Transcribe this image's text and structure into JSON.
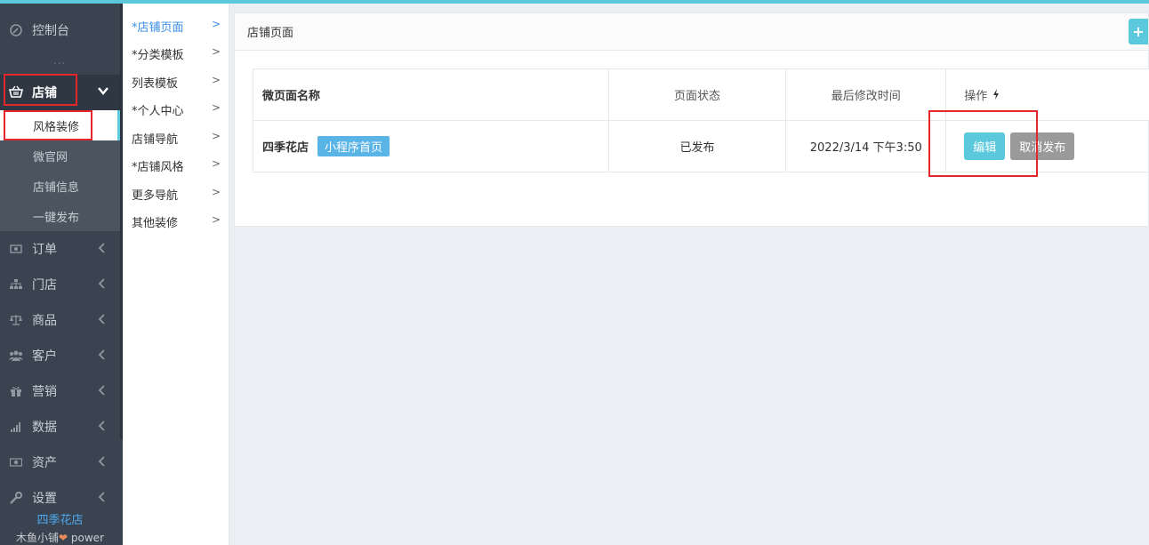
{
  "sidebar": {
    "dashboard": "控制台",
    "dots": "...",
    "shop": "店铺",
    "sub_items": [
      "风格装修",
      "微官网",
      "店铺信息",
      "一键发布"
    ],
    "items": [
      {
        "label": "订单",
        "icon": "money-icon"
      },
      {
        "label": "门店",
        "icon": "sitemap-icon"
      },
      {
        "label": "商品",
        "icon": "balance-scale-icon"
      },
      {
        "label": "客户",
        "icon": "users-icon"
      },
      {
        "label": "营销",
        "icon": "gift-icon"
      },
      {
        "label": "数据",
        "icon": "signal-icon"
      },
      {
        "label": "资产",
        "icon": "cash-icon"
      },
      {
        "label": "设置",
        "icon": "wrench-icon"
      }
    ],
    "brand": "四季花店",
    "power_prefix": "木鱼小铺",
    "power_suffix": "power"
  },
  "menu2": {
    "items": [
      "*店铺页面",
      "*分类模板",
      "列表模板",
      "*个人中心",
      "店铺导航",
      "*店铺风格",
      "更多导航",
      "其他装修"
    ],
    "active_index": 0
  },
  "panel": {
    "title": "店铺页面",
    "add_label": "+",
    "table": {
      "headers": [
        "微页面名称",
        "页面状态",
        "最后修改时间",
        "操作"
      ],
      "rows": [
        {
          "name": "四季花店",
          "tag": "小程序首页",
          "status": "已发布",
          "modified": "2022/3/14 下午3:50",
          "edit": "编辑",
          "cancel": "取消发布"
        }
      ]
    }
  },
  "colors": {
    "accent": "#5bc8dc",
    "sidebar_bg": "#3a4450",
    "highlight_box": "#e5262b",
    "tag_bg": "#5bb4e6"
  }
}
